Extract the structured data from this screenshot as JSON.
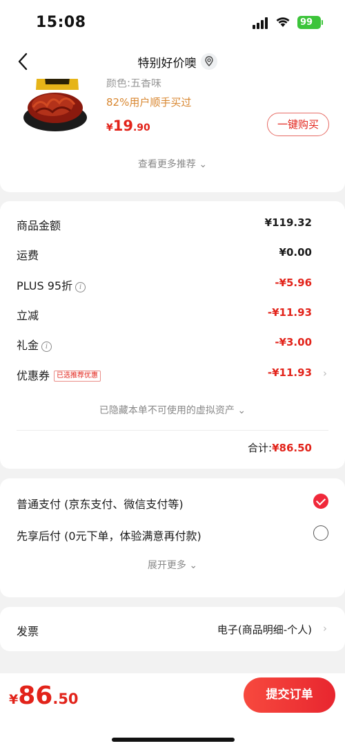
{
  "status_bar": {
    "time": "15:08",
    "battery": "99"
  },
  "nav": {
    "title": "特别好价噢"
  },
  "product": {
    "spec": "颜色:五香味",
    "sold_hint": "82%用户顺手买过",
    "price_symbol": "¥",
    "price_int": "19",
    "price_dec": ".90",
    "buy_label": "一键购买",
    "more_recommend": "查看更多推荐 ⌄"
  },
  "summary": {
    "rows": [
      {
        "label": "商品金额",
        "value": "¥119.32",
        "red": false
      },
      {
        "label": "运费",
        "value": "¥0.00",
        "red": false
      },
      {
        "label": "PLUS 95折",
        "value": "-¥5.96",
        "red": true
      },
      {
        "label": "立减",
        "value": "-¥11.93",
        "red": true
      },
      {
        "label": "礼金",
        "value": "-¥3.00",
        "red": true
      },
      {
        "label": "优惠券",
        "value": "-¥11.93",
        "red": true,
        "tag": "已选推荐优惠"
      }
    ],
    "hidden_assets": "已隐藏本单不可使用的虚拟资产 ⌄",
    "total_label": "合计:",
    "total_value": "¥86.50"
  },
  "payment": {
    "options": [
      {
        "label": "普通支付 (京东支付、微信支付等)",
        "selected": true
      },
      {
        "label": "先享后付 (0元下单，体验满意再付款)",
        "selected": false
      }
    ],
    "expand": "展开更多 ⌄"
  },
  "invoice": {
    "label": "发票",
    "value": "电子(商品明细-个人)"
  },
  "bottom": {
    "price_symbol": "¥",
    "price_int": "86",
    "price_dec": ".50",
    "submit_label": "提交订单"
  },
  "colors": {
    "accent": "#e2231a",
    "hint_orange": "#d8862f",
    "check_red": "#f0283a"
  }
}
